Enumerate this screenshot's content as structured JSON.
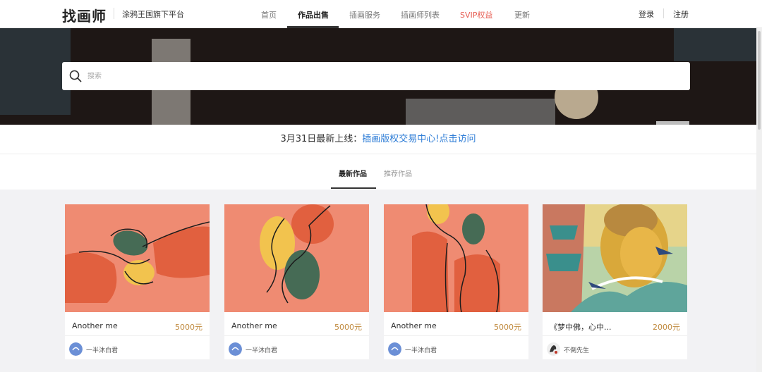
{
  "header": {
    "logo": "找画师",
    "slogan": "涂鸦王国旗下平台",
    "nav": [
      "首页",
      "作品出售",
      "插画服务",
      "插画师列表",
      "SVIP权益",
      "更新"
    ],
    "active_nav": "作品出售",
    "login": "登录",
    "register": "注册"
  },
  "search": {
    "placeholder": "搜索"
  },
  "notice": {
    "prefix": "3月31日最新上线：",
    "link": "插画版权交易中心!点击访问"
  },
  "tabs": [
    "最新作品",
    "推荐作品"
  ],
  "active_tab": "最新作品",
  "colors": {
    "accent_price": "#c08a3e",
    "vip": "#e65b50",
    "link": "#2b7bd6"
  },
  "cards": [
    {
      "title": "Another me",
      "price": "5000元",
      "author": "一半沐白君"
    },
    {
      "title": "Another me",
      "price": "5000元",
      "author": "一半沐白君"
    },
    {
      "title": "Another me",
      "price": "5000元",
      "author": "一半沐白君"
    },
    {
      "title": "《梦中佛，心中...",
      "price": "2000元",
      "author": "不倒先生"
    }
  ]
}
